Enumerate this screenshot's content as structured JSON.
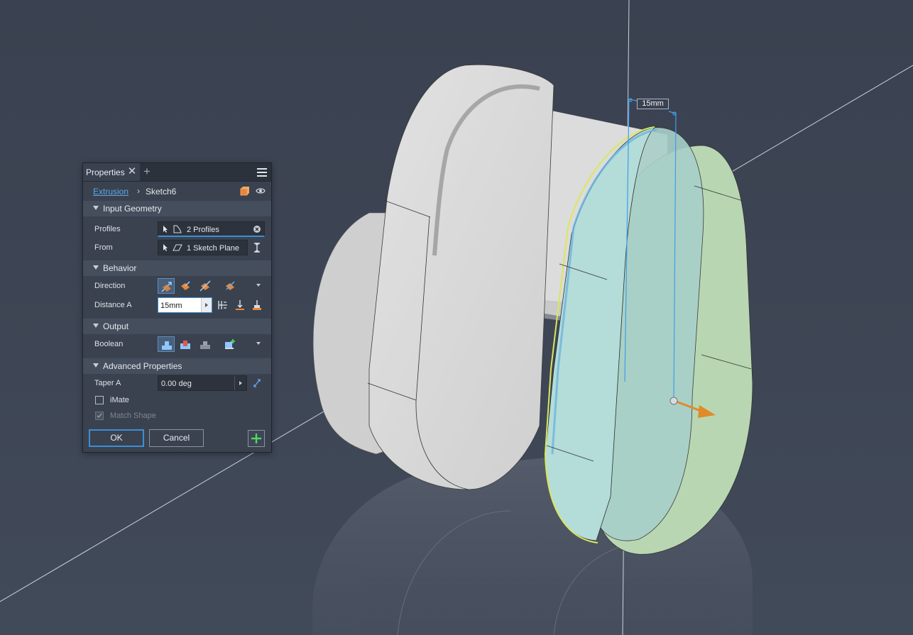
{
  "panel": {
    "tab_title": "Properties",
    "close_glyph": "✕",
    "add_glyph": "+",
    "breadcrumb": {
      "feature": "Extrusion",
      "separator": "›",
      "sketch": "Sketch6"
    },
    "sections": {
      "input_geometry": "Input Geometry",
      "behavior": "Behavior",
      "output": "Output",
      "advanced": "Advanced Properties"
    },
    "profiles": {
      "label": "Profiles",
      "value": "2 Profiles"
    },
    "from": {
      "label": "From",
      "value": "1 Sketch Plane"
    },
    "direction": {
      "label": "Direction",
      "selected": "default"
    },
    "distance_a": {
      "label": "Distance A",
      "value": "15mm"
    },
    "boolean": {
      "label": "Boolean",
      "selected": "join"
    },
    "taper_a": {
      "label": "Taper A",
      "value": "0.00 deg"
    },
    "imate": {
      "label": "iMate",
      "checked": false
    },
    "match_shape": {
      "label": "Match Shape",
      "checked": true,
      "disabled": true
    },
    "ok_label": "OK",
    "cancel_label": "Cancel"
  },
  "viewport": {
    "dimension_label": "15mm",
    "background_color": "#3b4352",
    "preview_color": "#b7dcc8",
    "accent_orange": "#e08a2a"
  }
}
